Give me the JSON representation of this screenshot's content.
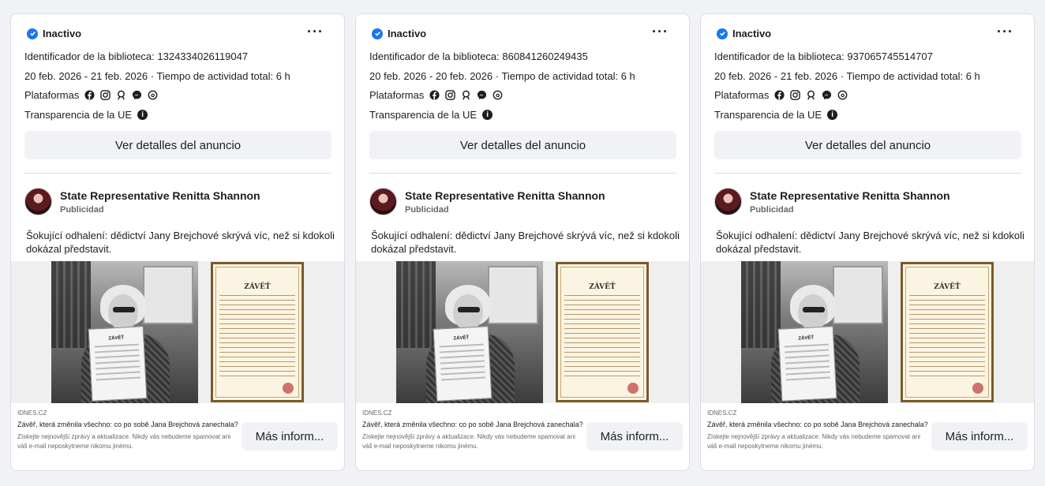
{
  "colors": {
    "accent": "#1877f2",
    "background": "#f0f2f5",
    "muted": "#65676b"
  },
  "cards": [
    {
      "status": "Inactivo",
      "more_icon": "more-horizontal-icon",
      "library_id": "Identificador de la biblioteca: 1324334026119047",
      "dates": "20 feb. 2026 - 21 feb. 2026 · Tiempo de actividad total: 6 h",
      "platforms_label": "Plataformas",
      "platform_icons": [
        "facebook-icon",
        "instagram-icon",
        "audience-network-icon",
        "messenger-icon",
        "threads-icon"
      ],
      "eu_label": "Transparencia de la UE",
      "details_button": "Ver detalles del anuncio",
      "advertiser": "State Representative Renitta Shannon",
      "advertiser_sub": "Publicidad",
      "body": "Šokující odhalení: dědictví Jany Brejchové skrývá víc, než si kdokoli dokázal představit.",
      "certificate_title": "ZÁVĚŤ",
      "held_doc_title": "ZÁVĚŤ",
      "link_domain": "IDNES.CZ",
      "link_title": "Závěř, která změnila všechno: co po sobě Jana Brejchová zanechala?",
      "link_desc": "Získejte nejnovější zprávy a aktualizace. Nikdy vás nebudeme spamovat ani váš e-mail neposkytneme nikomu jinému.",
      "cta": "Más inform..."
    },
    {
      "status": "Inactivo",
      "more_icon": "more-horizontal-icon",
      "library_id": "Identificador de la biblioteca: 860841260249435",
      "dates": "20 feb. 2026 - 20 feb. 2026 · Tiempo de actividad total: 6 h",
      "platforms_label": "Plataformas",
      "platform_icons": [
        "facebook-icon",
        "instagram-icon",
        "audience-network-icon",
        "messenger-icon",
        "threads-icon"
      ],
      "eu_label": "Transparencia de la UE",
      "details_button": "Ver detalles del anuncio",
      "advertiser": "State Representative Renitta Shannon",
      "advertiser_sub": "Publicidad",
      "body": "Šokující odhalení: dědictví Jany Brejchové skrývá víc, než si kdokoli dokázal představit.",
      "certificate_title": "ZÁVĚŤ",
      "held_doc_title": "ZÁVĚŤ",
      "link_domain": "IDNES.CZ",
      "link_title": "Závěř, která změnila všechno: co po sobě Jana Brejchová zanechala?",
      "link_desc": "Získejte nejnovější zprávy a aktualizace. Nikdy vás nebudeme spamovat ani váš e-mail neposkytneme nikomu jinému.",
      "cta": "Más inform..."
    },
    {
      "status": "Inactivo",
      "more_icon": "more-horizontal-icon",
      "library_id": "Identificador de la biblioteca: 937065745514707",
      "dates": "20 feb. 2026 - 21 feb. 2026 · Tiempo de actividad total: 6 h",
      "platforms_label": "Plataformas",
      "platform_icons": [
        "facebook-icon",
        "instagram-icon",
        "audience-network-icon",
        "messenger-icon",
        "threads-icon"
      ],
      "eu_label": "Transparencia de la UE",
      "details_button": "Ver detalles del anuncio",
      "advertiser": "State Representative Renitta Shannon",
      "advertiser_sub": "Publicidad",
      "body": "Šokující odhalení: dědictví Jany Brejchové skrývá víc, než si kdokoli dokázal představit.",
      "certificate_title": "ZÁVĚŤ",
      "held_doc_title": "ZÁVĚŤ",
      "link_domain": "IDNES.CZ",
      "link_title": "Závěř, která změnila všechno: co po sobě Jana Brejchová zanechala?",
      "link_desc": "Získejte nejnovější zprávy a aktualizace. Nikdy vás nebudeme spamovat ani váš e-mail neposkytneme nikomu jinému.",
      "cta": "Más inform..."
    }
  ]
}
